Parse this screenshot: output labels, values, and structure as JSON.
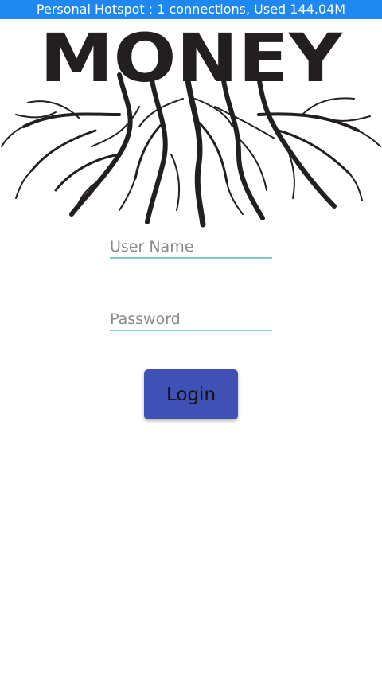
{
  "status_bar": {
    "text": "Personal Hotspot : 1 connections, Used 144.04M"
  },
  "logo": {
    "text": "MONEY",
    "image": "money-roots-logo"
  },
  "form": {
    "username_placeholder": "User Name",
    "username_value": "",
    "password_placeholder": "Password",
    "password_value": "",
    "login_label": "Login"
  },
  "colors": {
    "status_bar": "#1e88f0",
    "field_underline": "#7fc9c9",
    "button": "#3f51b5"
  }
}
